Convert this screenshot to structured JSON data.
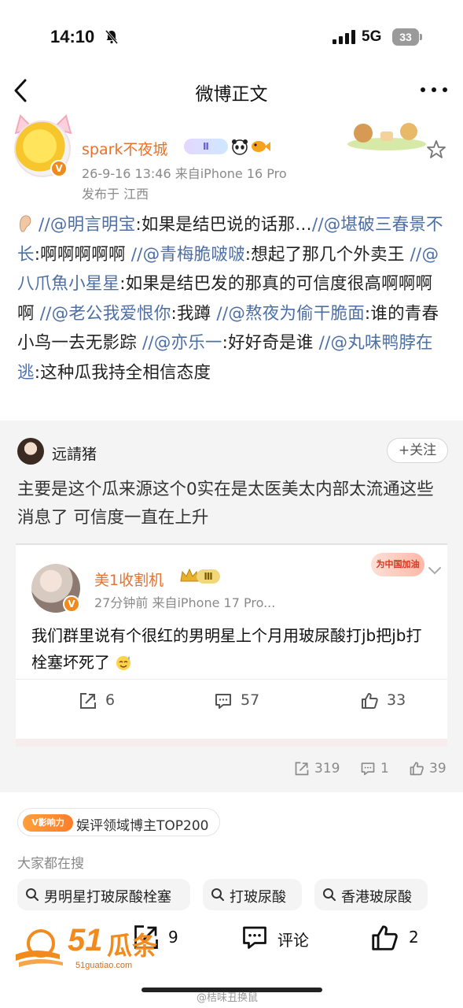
{
  "status_bar": {
    "time": "14:10",
    "network": "5G",
    "battery": "33"
  },
  "navbar": {
    "title": "微博正文"
  },
  "post": {
    "author": "spark不夜城",
    "level_badge": "Ⅱ",
    "meta": "26-9-16 13:46  来自iPhone 16 Pro",
    "location": "发布于 江西",
    "body": [
      {
        "t": "sep",
        "v": " //"
      },
      {
        "t": "at",
        "v": "@明言明宝"
      },
      {
        "t": "text",
        "v": ":如果是结巴说的话那…"
      },
      {
        "t": "sep",
        "v": "//"
      },
      {
        "t": "at",
        "v": "@堪破三春景不长"
      },
      {
        "t": "text",
        "v": ":啊啊啊啊啊 "
      },
      {
        "t": "sep",
        "v": "//"
      },
      {
        "t": "at",
        "v": "@青梅脆啵啵"
      },
      {
        "t": "text",
        "v": ":想起了那几个外卖王 "
      },
      {
        "t": "sep",
        "v": "//"
      },
      {
        "t": "at",
        "v": "@八爪魚小星星"
      },
      {
        "t": "text",
        "v": ":如果是结巴发的那真的可信度很高啊啊啊啊 "
      },
      {
        "t": "sep",
        "v": "//"
      },
      {
        "t": "at",
        "v": "@老公我爱恨你"
      },
      {
        "t": "text",
        "v": ":我蹲 "
      },
      {
        "t": "sep",
        "v": "//"
      },
      {
        "t": "at",
        "v": "@熬夜为偷干脆面"
      },
      {
        "t": "text",
        "v": ":谁的青春小鸟一去无影踪 "
      },
      {
        "t": "sep",
        "v": "//"
      },
      {
        "t": "at",
        "v": "@亦乐一"
      },
      {
        "t": "text",
        "v": ":好好奇是谁 "
      },
      {
        "t": "sep",
        "v": "//"
      },
      {
        "t": "at",
        "v": "@丸味鸭脖在逃"
      },
      {
        "t": "text",
        "v": ":这种瓜我持全相信态度"
      }
    ]
  },
  "retweet": {
    "user": "远請猪",
    "follow_label": "+关注",
    "text": "主要是这个瓜来源这个0实在是太医美太内部太流通这些消息了 可信度一直在上升",
    "actions": {
      "reposts": "319",
      "comments": "1",
      "likes": "39"
    },
    "quoted": {
      "user": "美1收割机",
      "level_badge": "Ⅲ",
      "badge": "为中国加油",
      "meta": "27分钟前  来自iPhone 17 Pro...",
      "text": "我们群里说有个很红的男明星上个月用玻尿酸打jb把jb打栓塞坏死了",
      "reposts": "6",
      "comments": "57",
      "likes": "33"
    }
  },
  "influence": {
    "tag": "V影响力",
    "text": "娱评领域博主TOP200"
  },
  "trending": {
    "heading": "大家都在搜",
    "chips": [
      "男明星打玻尿酸栓塞",
      "打玻尿酸",
      "香港玻尿酸"
    ]
  },
  "bottom_bar": {
    "reposts": "9",
    "comment_label": "评论",
    "likes": "2"
  },
  "watermark": {
    "brand_num": "51",
    "brand_cn": "瓜条",
    "url": "51guatiao.com",
    "weibo": "@桔味丑换鼠"
  },
  "colors": {
    "link": "#4d6fa6",
    "name_orange": "#e8722c",
    "brand_orange": "#f28a1c"
  }
}
